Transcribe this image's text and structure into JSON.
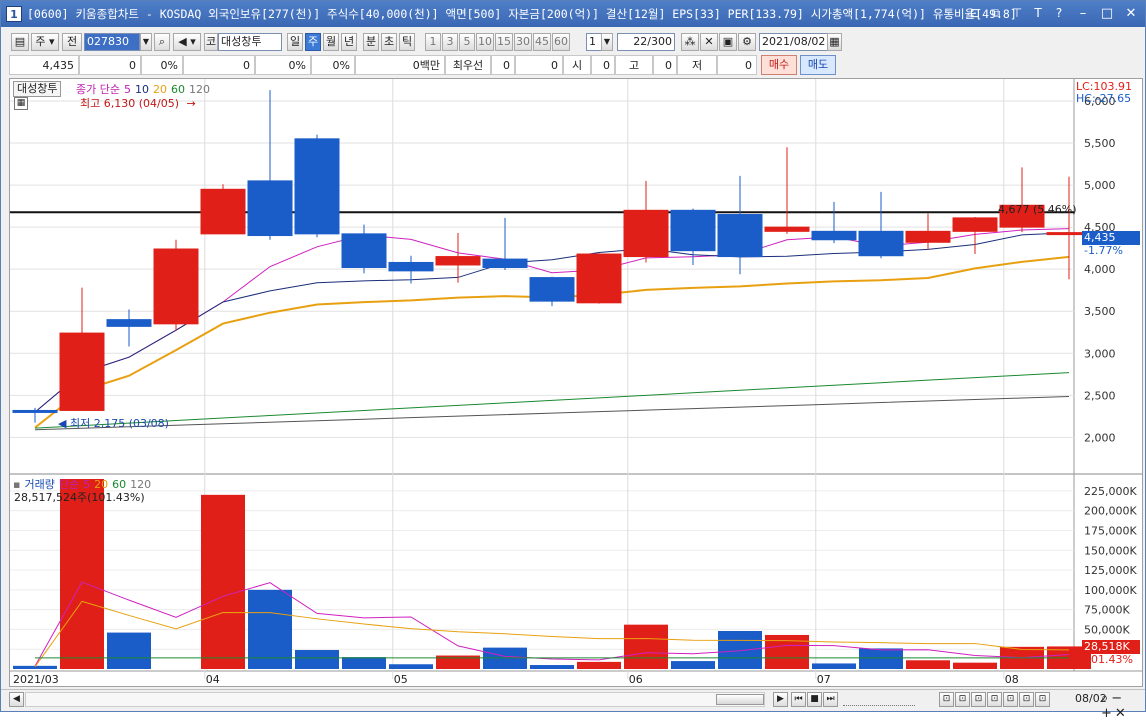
{
  "window": {
    "screen_no": "1",
    "title": "[0600] 키움종합차트 - KOSDAQ 외국인보유[277(천)] 주식수[40,000(천)] 액면[500] 자본금[200(억)] 결산[12월] EPS[33] PER[133.79] 시가총액[1,774(억)] 유통비율[49.8]"
  },
  "toolbar": {
    "market_select": "주",
    "prev_label": "전",
    "code": "027830",
    "stock_name": "대성창투",
    "code_prefix": "코",
    "periods": [
      "일",
      "주",
      "월",
      "년",
      "분",
      "초",
      "틱"
    ],
    "active_period": "주",
    "minute_units": [
      "1",
      "3",
      "5",
      "10",
      "15",
      "30",
      "45",
      "60"
    ],
    "unit_value": "1",
    "count": "22",
    "count_total": "/300",
    "date": "2021/08/02"
  },
  "inforow": {
    "price": "4,435",
    "change": "0",
    "change_pct": "0%",
    "volume": "0",
    "volume_pct": "0%",
    "other_pct": "0%",
    "amount": "0백만",
    "best_label": "최우선",
    "best_ask": "0",
    "best_bid": "0",
    "open_label": "시",
    "open": "0",
    "high_label": "고",
    "high": "0",
    "low_label": "저",
    "low": "0",
    "buy_label": "매수",
    "sell_label": "매도"
  },
  "price_pane": {
    "stock_label": "대성창투",
    "legend": {
      "prefix": "종가 단순",
      "periods": [
        "5",
        "10",
        "20",
        "60",
        "120"
      ]
    },
    "max_marker": "최고 6,130 (04/05)",
    "min_marker": "최저 2,175 (03/08)",
    "last_marker": "4,677 (5.46%)",
    "lc": "LC:103.91",
    "hc": "HC:-27.65",
    "price_tag": "4,435",
    "price_tag_pct": "-1.77%",
    "y_ticks": [
      "6,000",
      "5,500",
      "5,000",
      "4,500",
      "4,000",
      "3,500",
      "3,000",
      "2,500",
      "2,000"
    ]
  },
  "volume_pane": {
    "legend_prefix": "거래량",
    "legend": {
      "prefix": "단순",
      "periods": [
        "5",
        "20",
        "60",
        "120"
      ]
    },
    "value_text": "28,517,524주(101.43%)",
    "tag_value": "28,518K",
    "tag_pct": "101.43%",
    "y_ticks": [
      "225,000K",
      "200,000K",
      "175,000K",
      "150,000K",
      "125,000K",
      "100,000K",
      "75,000K",
      "50,000K",
      "25,000K"
    ]
  },
  "x_axis": {
    "labels": [
      "2021/03",
      "04",
      "05",
      "06",
      "07",
      "08"
    ],
    "right_label": "08/02"
  },
  "colors": {
    "up": "#e02018",
    "down": "#1a5cc8",
    "ma5": "#d020c0",
    "ma10": "#1a2e7a",
    "ma20": "#e8a010",
    "ma60": "#1a8a30",
    "ma120": "#555555"
  },
  "chart_data": {
    "type": "candlestick",
    "title": "",
    "x": [
      "03/01",
      "03/08",
      "03/15",
      "03/22",
      "03/29",
      "04/05",
      "04/12",
      "04/19",
      "04/26",
      "05/03",
      "05/10",
      "05/17",
      "05/24",
      "05/31",
      "06/07",
      "06/14",
      "06/21",
      "06/28",
      "07/05",
      "07/12",
      "07/19",
      "07/26",
      "08/02"
    ],
    "open": [
      2320,
      2320,
      3400,
      3350,
      4420,
      5050,
      5550,
      4420,
      4080,
      4050,
      4120,
      3900,
      3600,
      4150,
      4700,
      4650,
      4450,
      4450,
      4450,
      4320,
      4450,
      4500,
      4435
    ],
    "close": [
      2300,
      3240,
      3320,
      4240,
      4950,
      4400,
      4420,
      4020,
      3980,
      4150,
      4020,
      3620,
      4180,
      4700,
      4220,
      4150,
      4500,
      4350,
      4160,
      4450,
      4610,
      4760,
      4435
    ],
    "high": [
      2350,
      3780,
      3520,
      4350,
      5010,
      6130,
      5600,
      4530,
      4160,
      4430,
      4610,
      3910,
      4190,
      5050,
      4720,
      5110,
      5450,
      4800,
      4920,
      4660,
      4620,
      5210,
      5100
    ],
    "low": [
      2175,
      3200,
      3080,
      3270,
      4920,
      4350,
      4380,
      3950,
      3830,
      3840,
      3990,
      3560,
      3590,
      4080,
      4050,
      3940,
      4420,
      4310,
      4130,
      4230,
      4180,
      4440,
      3880
    ],
    "volume_k": [
      4000,
      240000,
      46000,
      0,
      220000,
      100000,
      24000,
      15000,
      6000,
      17000,
      27000,
      5000,
      9000,
      56000,
      10000,
      48000,
      43000,
      7000,
      26000,
      11000,
      8000,
      28000,
      28518
    ],
    "ylim": [
      1600,
      6000
    ],
    "volume_ylim": [
      0,
      240000
    ]
  }
}
